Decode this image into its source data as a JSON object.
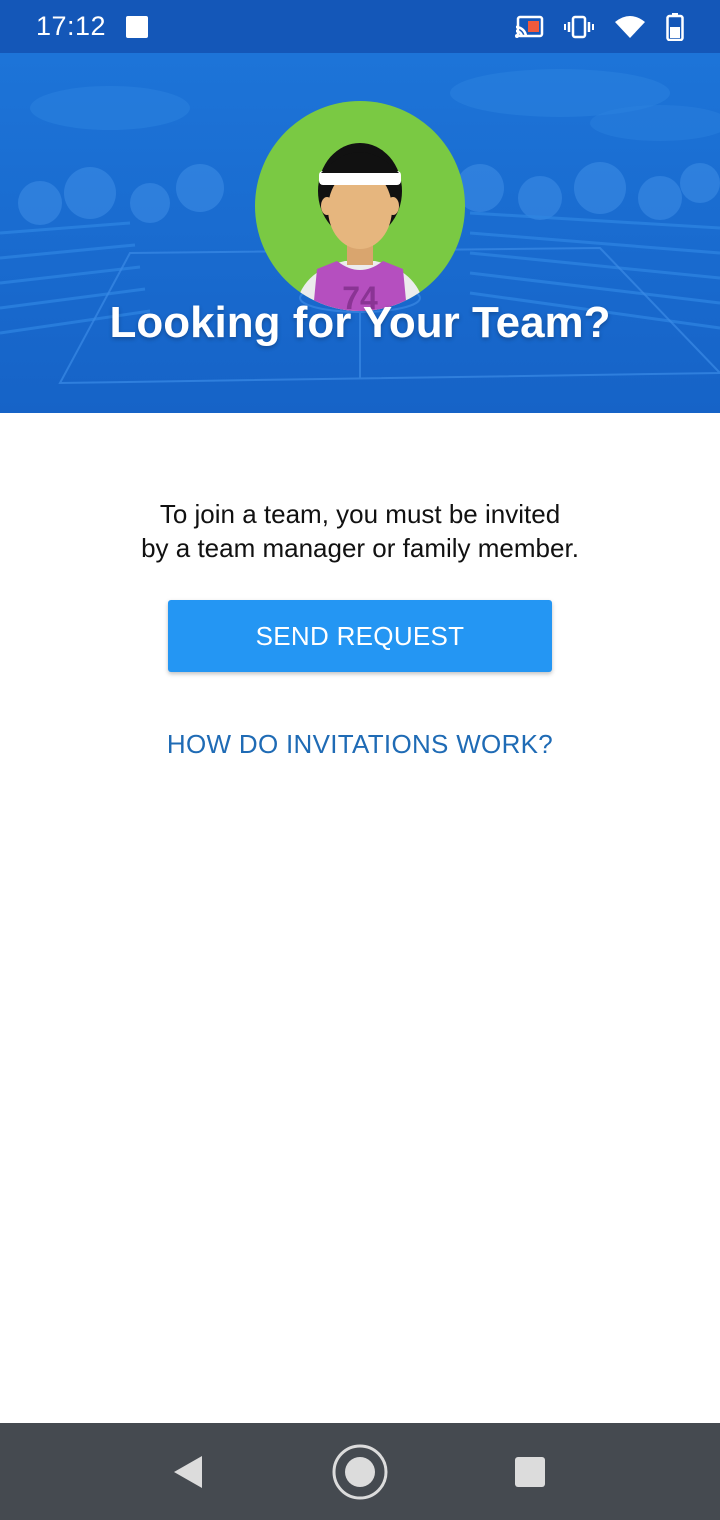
{
  "status_bar": {
    "time": "17:12",
    "icons": [
      "notification-square-icon",
      "cast-icon",
      "vibrate-icon",
      "wifi-icon",
      "battery-icon"
    ]
  },
  "hero": {
    "title": "Looking for Your Team?",
    "avatar": {
      "jersey_number": "74"
    }
  },
  "main": {
    "info_line_1": "To join a team, you must be invited",
    "info_line_2": "by a team manager or family member.",
    "send_request_label": "SEND REQUEST",
    "how_invitations_label": "HOW DO INVITATIONS WORK?"
  },
  "nav_bar": {
    "icons": [
      "back-icon",
      "home-icon",
      "recents-icon"
    ]
  },
  "colors": {
    "status_bar": "#1457b8",
    "hero": "#1a6fd6",
    "button": "#2496f3",
    "link": "#1f6bb5",
    "nav_bar": "#454a50",
    "avatar_bg": "#7ac943"
  }
}
